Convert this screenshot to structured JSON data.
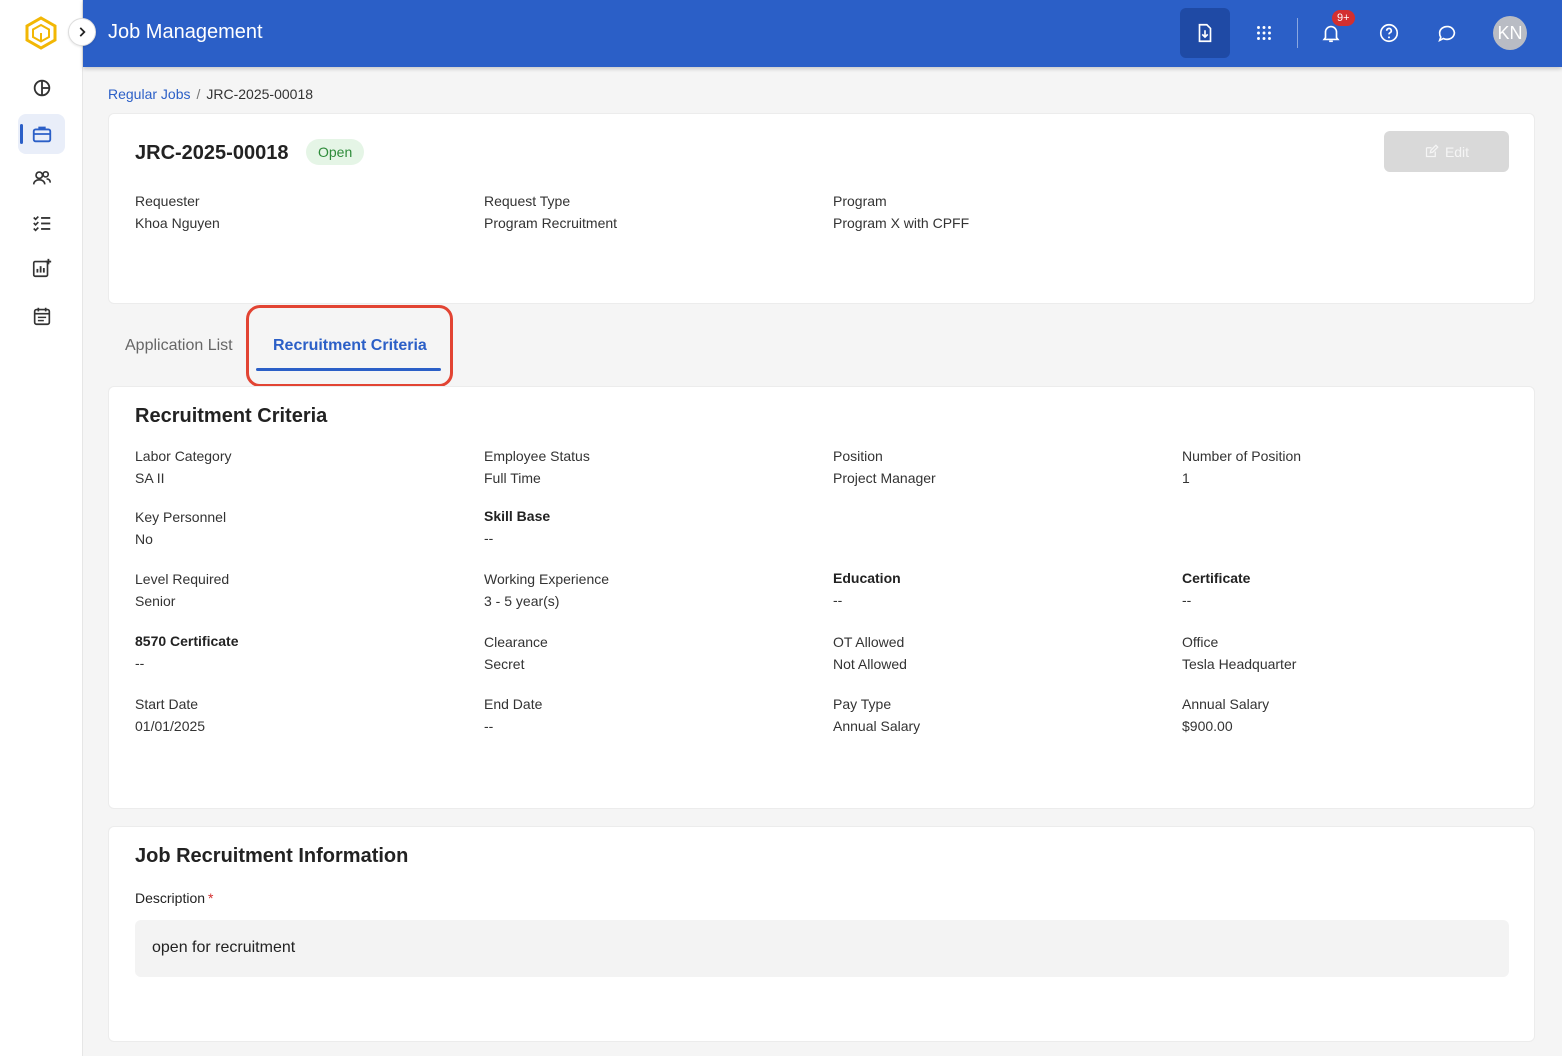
{
  "app": {
    "title": "Job Management"
  },
  "topbar": {
    "notification_badge": "9+",
    "avatar_initials": "KN"
  },
  "breadcrumb": {
    "parent": "Regular Jobs",
    "separator": "/",
    "current": "JRC-2025-00018"
  },
  "job": {
    "id": "JRC-2025-00018",
    "status": "Open",
    "edit_label": "Edit",
    "fields": [
      {
        "label": "Requester",
        "value": "Khoa Nguyen"
      },
      {
        "label": "Request Type",
        "value": "Program Recruitment"
      },
      {
        "label": "Program",
        "value": "Program X with CPFF"
      }
    ]
  },
  "tabs": [
    {
      "label": "Application List",
      "active": false
    },
    {
      "label": "Recruitment Criteria",
      "active": true
    }
  ],
  "criteria": {
    "title": "Recruitment Criteria",
    "fields": [
      {
        "label": "Labor Category",
        "value": "SA II"
      },
      {
        "label": "Employee Status",
        "value": "Full Time"
      },
      {
        "label": "Position",
        "value": "Project Manager"
      },
      {
        "label": "Number of Position",
        "value": "1"
      },
      {
        "label": "Key Personnel",
        "value": "No"
      },
      {
        "label": "Skill Base",
        "value": "--"
      },
      {
        "label": "Level Required",
        "value": "Senior"
      },
      {
        "label": "Working Experience",
        "value": "3 - 5 year(s)"
      },
      {
        "label": "Education",
        "value": "--"
      },
      {
        "label": "Certificate",
        "value": "--"
      },
      {
        "label": "8570 Certificate",
        "value": "--"
      },
      {
        "label": "Clearance",
        "value": "Secret"
      },
      {
        "label": "OT Allowed",
        "value": "Not Allowed"
      },
      {
        "label": "Office",
        "value": "Tesla Headquarter"
      },
      {
        "label": "Start Date",
        "value": "01/01/2025"
      },
      {
        "label": "End Date",
        "value": "--"
      },
      {
        "label": "Pay Type",
        "value": "Annual Salary"
      },
      {
        "label": "Annual Salary",
        "value": "$900.00"
      }
    ]
  },
  "recruitment_info": {
    "title": "Job Recruitment Information",
    "description_label": "Description",
    "required_mark": "*",
    "description_value": "open for recruitment"
  },
  "colors": {
    "primary": "#2b5fc7",
    "status_green": "#2e8b3a",
    "highlight_red": "#e24433"
  }
}
